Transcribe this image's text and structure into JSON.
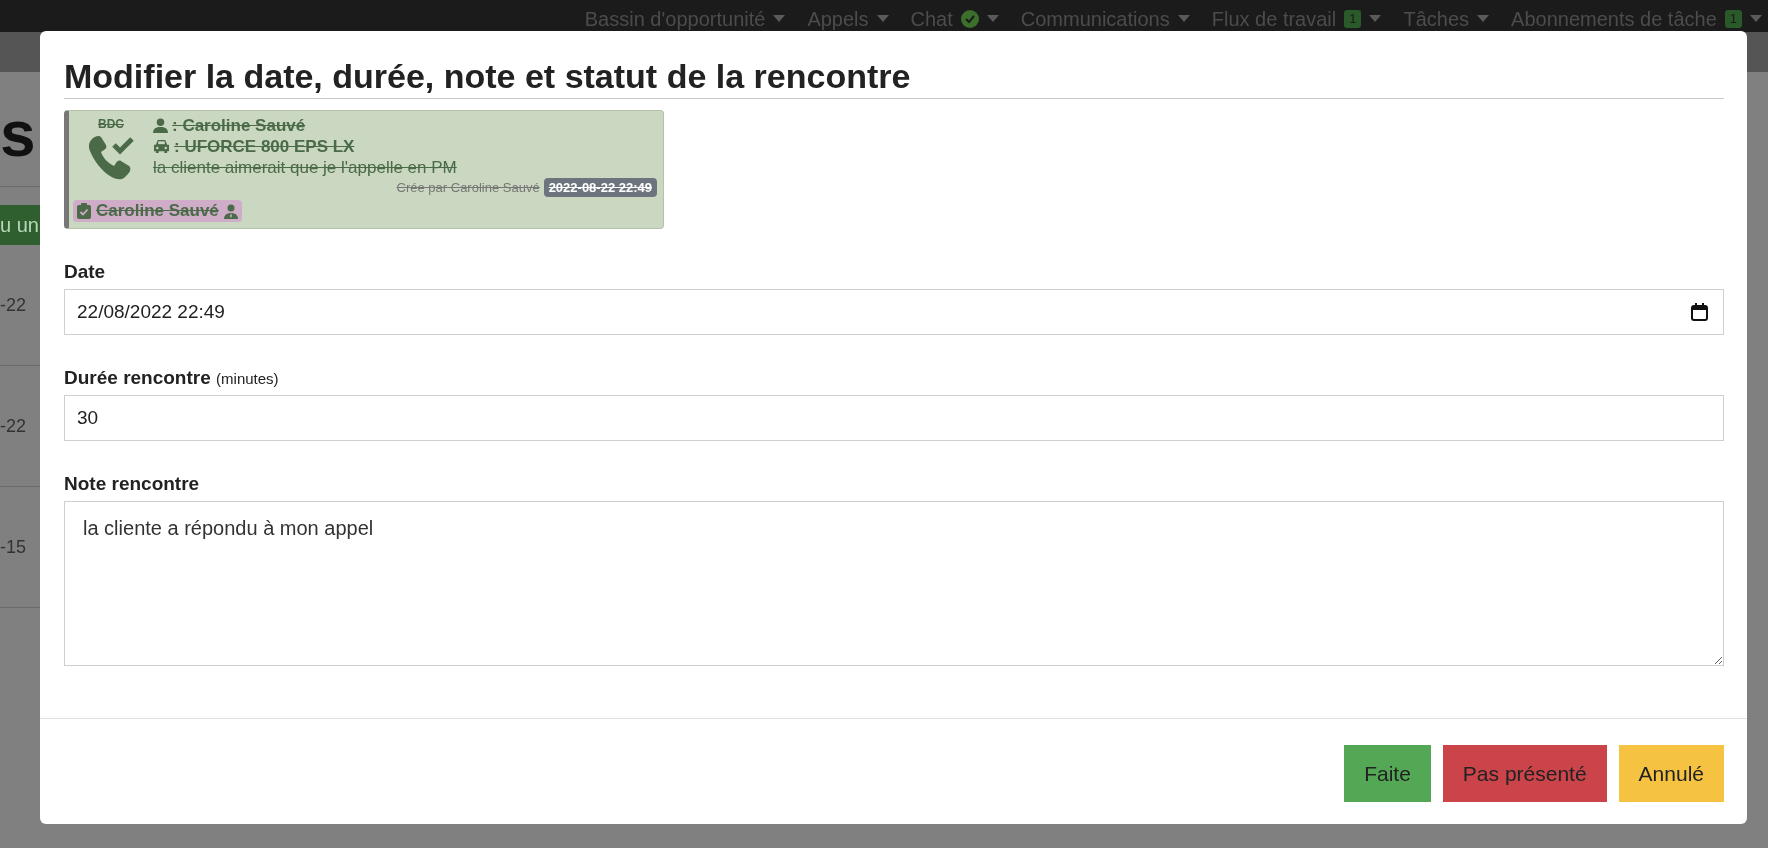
{
  "nav": {
    "items": [
      {
        "label": "Bassin d'opportunité",
        "kind": "plain"
      },
      {
        "label": "Appels",
        "kind": "plain"
      },
      {
        "label": "Chat",
        "kind": "status"
      },
      {
        "label": "Communications",
        "kind": "plain"
      },
      {
        "label": "Flux de travail",
        "kind": "badge",
        "badge": "1"
      },
      {
        "label": "Tâches",
        "kind": "plain"
      },
      {
        "label": "Abonnements de tâche",
        "kind": "badge",
        "badge": "1"
      }
    ]
  },
  "background": {
    "heading": "s",
    "button": "u un",
    "rows": [
      "-22",
      "-22",
      "-15"
    ]
  },
  "modal": {
    "title": "Modifier la date, durée, note et statut de la rencontre",
    "card": {
      "source": "BDC",
      "client": ": Caroline Sauvé",
      "vehicle": ": UFORCE 800 EPS LX",
      "note": "la cliente aimerait que je l'appelle en PM",
      "created_by": "Crée par Caroline Sauvé",
      "timestamp": "2022-08-22 22:49",
      "assignee": "Caroline Sauvé",
      "struck": true
    },
    "fields": [
      {
        "kind": "datetime",
        "label": "Date",
        "value": "22/08/2022 22:49"
      },
      {
        "kind": "number",
        "label": "Durée rencontre",
        "hint": "(minutes)",
        "value": "30"
      },
      {
        "kind": "textarea",
        "label": "Note rencontre",
        "value": "la cliente a répondu à mon appel"
      }
    ],
    "buttons": [
      {
        "label": "Faite",
        "color": "#54a754"
      },
      {
        "label": "Pas présenté",
        "color": "#cb444a"
      },
      {
        "label": "Annulé",
        "color": "#f5c242"
      }
    ]
  }
}
